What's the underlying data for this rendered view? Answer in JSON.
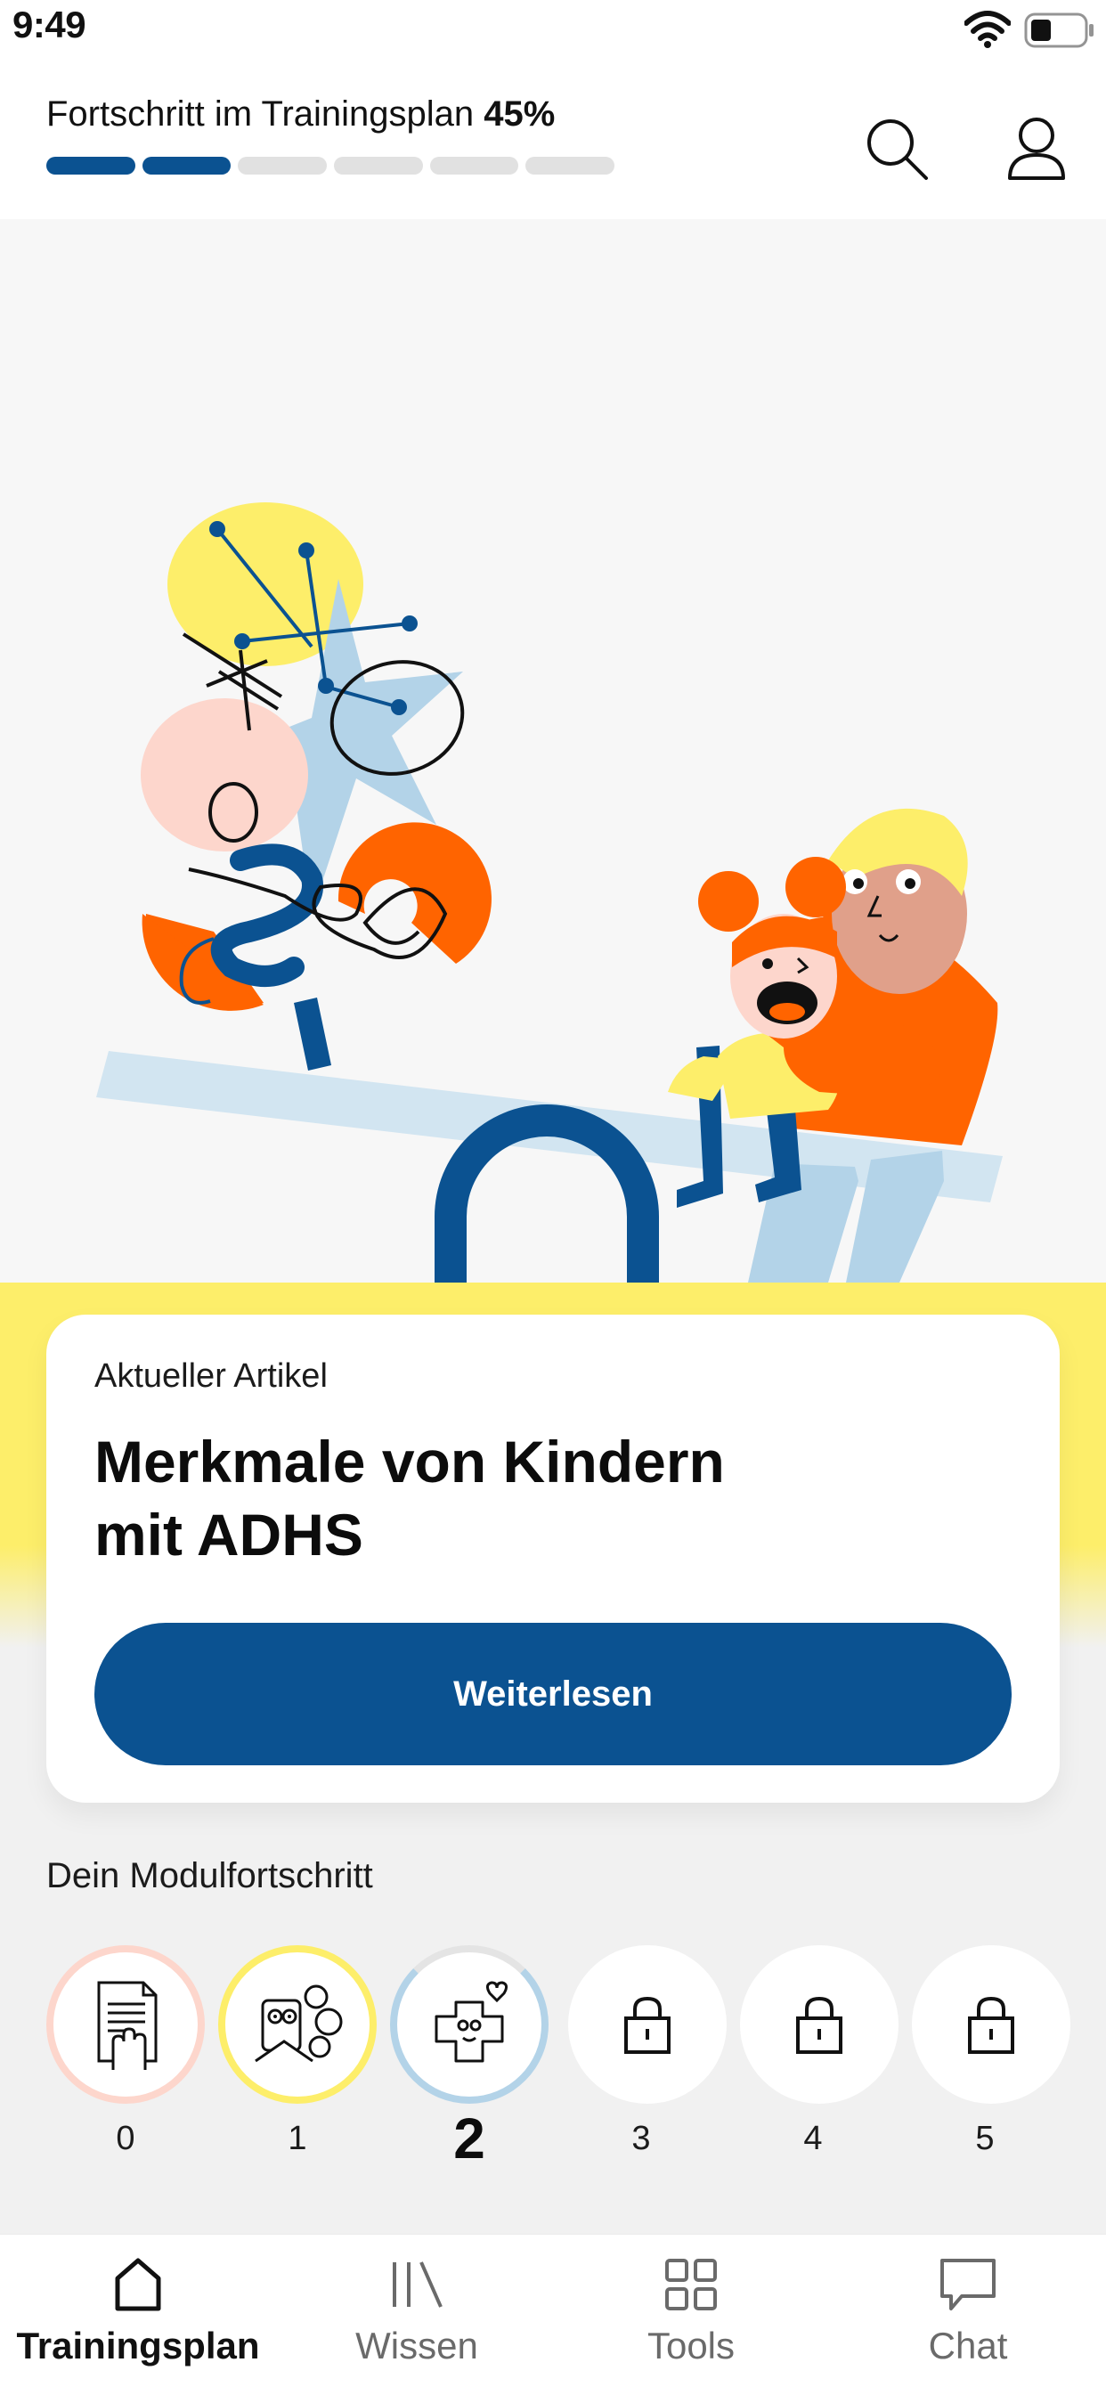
{
  "status_bar": {
    "time": "9:49"
  },
  "header": {
    "progress_label": "Fortschritt im Trainingsplan",
    "progress_percent": "45%",
    "progress_value": 0.45,
    "progress_segments_total": 6,
    "progress_segments_filled": 2,
    "search_icon": "search-icon",
    "profile_icon": "profile-icon"
  },
  "article": {
    "kicker": "Aktueller Artikel",
    "title": "Merkmale von Kindern\nmit ADHS",
    "button_label": "Weiterlesen"
  },
  "modules": {
    "heading": "Dein Modulfortschritt",
    "items": [
      {
        "number": "0",
        "state": "completed",
        "icon": "document-hand-icon",
        "color": "#fdd6cc"
      },
      {
        "number": "1",
        "state": "completed",
        "icon": "reading-person-icon",
        "color": "#fdee6a"
      },
      {
        "number": "2",
        "state": "current",
        "icon": "heart-character-icon",
        "color": "#b3d3e8"
      },
      {
        "number": "3",
        "state": "locked",
        "icon": "lock-icon"
      },
      {
        "number": "4",
        "state": "locked",
        "icon": "lock-icon"
      },
      {
        "number": "5",
        "state": "locked",
        "icon": "lock-icon"
      }
    ]
  },
  "tabbar": {
    "items": [
      {
        "label": "Trainingsplan",
        "icon": "home-icon",
        "active": true
      },
      {
        "label": "Wissen",
        "icon": "library-icon",
        "active": false
      },
      {
        "label": "Tools",
        "icon": "grid-icon",
        "active": false
      },
      {
        "label": "Chat",
        "icon": "chat-icon",
        "active": false
      }
    ]
  },
  "colors": {
    "brand_blue": "#0b5291",
    "accent_yellow": "#fdee6a",
    "accent_orange": "#ff6400",
    "accent_pink": "#fdd6cc",
    "accent_light_blue": "#b3d3e8"
  }
}
